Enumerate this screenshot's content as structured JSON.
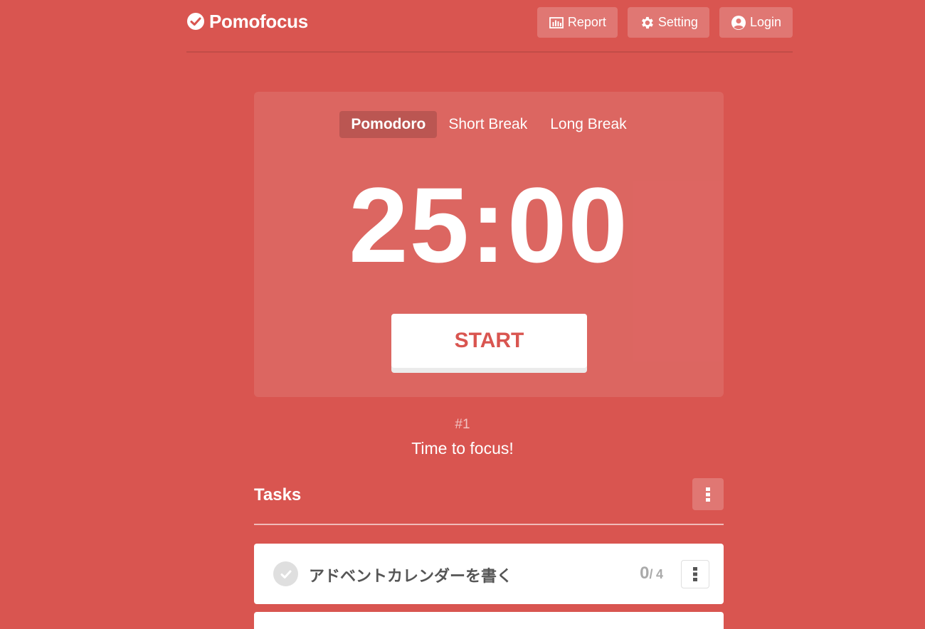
{
  "header": {
    "app_name": "Pomofocus",
    "nav": {
      "report": "Report",
      "setting": "Setting",
      "login": "Login"
    }
  },
  "timer_card": {
    "modes": [
      "Pomodoro",
      "Short Break",
      "Long Break"
    ],
    "active_mode": "Pomodoro",
    "time": "25:00",
    "start_label": "START"
  },
  "round": {
    "number": "#1",
    "message": "Time to focus!"
  },
  "tasks": {
    "title": "Tasks",
    "items": [
      {
        "title": "アドベントカレンダーを書く",
        "done_count": "0",
        "separator": "/",
        "total_count": "4"
      }
    ]
  },
  "colors": {
    "background": "#d95550",
    "accent": "#d95550",
    "card": "#ffffff"
  }
}
